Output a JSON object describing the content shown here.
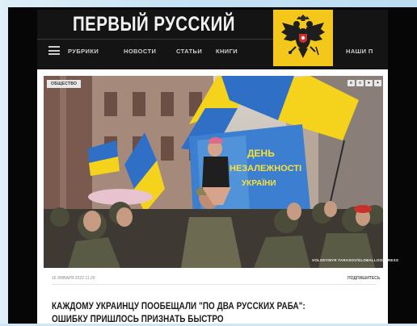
{
  "site": {
    "title": "ПЕРВЫЙ РУССКИЙ"
  },
  "nav": {
    "items": [
      "РУБРИКИ",
      "НОВОСТИ",
      "СТАТЬИ",
      "КНИГИ"
    ],
    "right_item": "НАШИ П"
  },
  "article": {
    "category": "ОБЩЕСТВО",
    "share_icons": [
      "vk-icon",
      "ok-icon",
      "telegram-icon",
      "twitter-icon"
    ],
    "banner_text": [
      "ДЕНЬ",
      "НЕЗАЛЕЖНОСТІ",
      "УКРАЇНИ"
    ],
    "photo_credit": "VOLODYMYR TARASOV/GLOBALLOOKPRESS",
    "date": "16 ЯНВАРЯ 2022 11:20",
    "subscribe_label": "ПОДПИШИТЕСЬ",
    "headline": "КАЖДОМУ УКРАИНЦУ ПООБЕЩАЛИ \"ПО ДВА РУССКИХ РАБА\": ОШИБКУ ПРИШЛОСЬ ПРИЗНАТЬ БЫСТРО"
  },
  "colors": {
    "header_bg": "#141414",
    "emblem_bg": "#f3c81a",
    "flag_blue": "#2f6fc6",
    "flag_yellow": "#f5d21c"
  }
}
